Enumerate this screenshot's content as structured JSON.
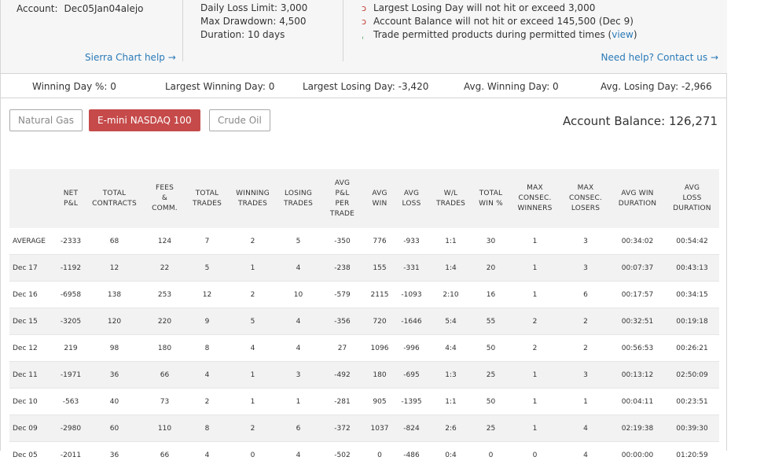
{
  "account": {
    "label": "Account:",
    "value": "Dec05Jan04alejo"
  },
  "limits": [
    "Daily Loss Limit: 3,000",
    "Max Drawdown: 4,500",
    "Duration: 10 days"
  ],
  "rules": [
    {
      "status": "fail",
      "icon": "x-mark-icon",
      "text": "Largest Losing Day will not hit or exceed 3,000"
    },
    {
      "status": "fail",
      "icon": "x-mark-icon",
      "text": "Account Balance will not hit or exceed 145,500 (Dec 9)"
    },
    {
      "status": "pass",
      "icon": "check-mark-icon",
      "text": "Trade permitted products during permitted times (",
      "link": "view",
      "suffix": ")"
    }
  ],
  "links": {
    "sierra": "Sierra Chart help →",
    "help": "Need help? Contact us →"
  },
  "stats": {
    "winning_day_pct": "Winning Day %: 0",
    "largest_win": "Largest Winning Day: 0",
    "largest_loss": "Largest Losing Day: -3,420",
    "avg_win_day": "Avg. Winning Day: 0",
    "avg_loss_day": "Avg. Losing Day: -2,966"
  },
  "products": [
    "Natural Gas",
    "E-mini NASDAQ 100",
    "Crude Oil"
  ],
  "selected_product": "E-mini NASDAQ 100",
  "balance": "Account Balance: 126,271",
  "colors": {
    "accent": "#c64a4a",
    "link": "#2a7ab8",
    "fail": "#c0392b",
    "pass": "#2e9b4a"
  },
  "table": {
    "headers": [
      "",
      "NET\nP&L",
      "TOTAL\nCONTRACTS",
      "FEES\n&\nCOMM.",
      "TOTAL\nTRADES",
      "WINNING\nTRADES",
      "LOSING\nTRADES",
      "AVG\nP&L\nPER\nTRADE",
      "AVG\nWIN",
      "AVG\nLOSS",
      "W/L\nTRADES",
      "TOTAL\nWIN %",
      "MAX\nCONSEC.\nWINNERS",
      "MAX\nCONSEC.\nLOSERS",
      "AVG WIN\nDURATION",
      "AVG\nLOSS\nDURATION"
    ],
    "rows": [
      [
        "AVERAGE",
        "-2333",
        "68",
        "124",
        "7",
        "2",
        "5",
        "-350",
        "776",
        "-933",
        "1:1",
        "30",
        "1",
        "3",
        "00:34:02",
        "00:54:42"
      ],
      [
        "Dec 17",
        "-1192",
        "12",
        "22",
        "5",
        "1",
        "4",
        "-238",
        "155",
        "-331",
        "1:4",
        "20",
        "1",
        "3",
        "00:07:37",
        "00:43:13"
      ],
      [
        "Dec 16",
        "-6958",
        "138",
        "253",
        "12",
        "2",
        "10",
        "-579",
        "2115",
        "-1093",
        "2:10",
        "16",
        "1",
        "6",
        "00:17:57",
        "00:34:15"
      ],
      [
        "Dec 15",
        "-3205",
        "120",
        "220",
        "9",
        "5",
        "4",
        "-356",
        "720",
        "-1646",
        "5:4",
        "55",
        "2",
        "2",
        "00:32:51",
        "00:19:18"
      ],
      [
        "Dec 12",
        "219",
        "98",
        "180",
        "8",
        "4",
        "4",
        "27",
        "1096",
        "-996",
        "4:4",
        "50",
        "2",
        "2",
        "00:56:53",
        "00:26:21"
      ],
      [
        "Dec 11",
        "-1971",
        "36",
        "66",
        "4",
        "1",
        "3",
        "-492",
        "180",
        "-695",
        "1:3",
        "25",
        "1",
        "3",
        "00:13:12",
        "02:50:09"
      ],
      [
        "Dec 10",
        "-563",
        "40",
        "73",
        "2",
        "1",
        "1",
        "-281",
        "905",
        "-1395",
        "1:1",
        "50",
        "1",
        "1",
        "00:04:11",
        "00:23:51"
      ],
      [
        "Dec 09",
        "-2980",
        "60",
        "110",
        "8",
        "2",
        "6",
        "-372",
        "1037",
        "-824",
        "2:6",
        "25",
        "1",
        "4",
        "02:19:38",
        "00:39:30"
      ],
      [
        "Dec 05",
        "-2011",
        "36",
        "66",
        "4",
        "0",
        "4",
        "-502",
        "0",
        "-486",
        "0:4",
        "0",
        "0",
        "4",
        "00:00:00",
        "01:20:59"
      ]
    ]
  }
}
